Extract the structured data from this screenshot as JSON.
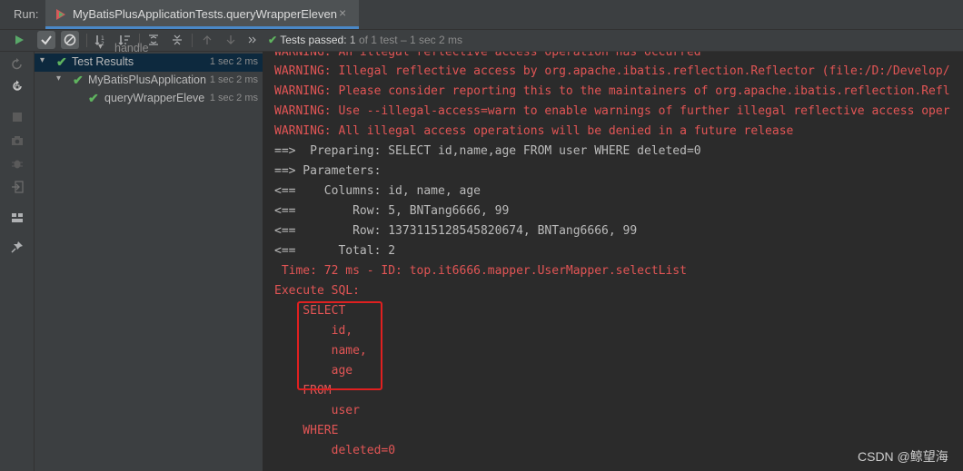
{
  "top": {
    "run_label": "Run:",
    "tab_title": "MyBatisPlusApplicationTests.queryWrapperEleven",
    "tab_close": "×"
  },
  "toolbar": {
    "status_passed": "Tests passed:",
    "status_count": "1",
    "status_detail": "of 1 test – 1 sec 2 ms"
  },
  "tree": {
    "partial_top": "handle",
    "items": [
      {
        "label": "Test Results",
        "duration": "1 sec 2 ms"
      },
      {
        "label": "MyBatisPlusApplication",
        "duration": "1 sec 2 ms"
      },
      {
        "label": "queryWrapperEleve",
        "duration": "1 sec 2 ms"
      }
    ]
  },
  "console": {
    "lines": [
      "WARNING: An illegal reflective access operation has occurred",
      "WARNING: Illegal reflective access by org.apache.ibatis.reflection.Reflector (file:/D:/Develop/",
      "WARNING: Please consider reporting this to the maintainers of org.apache.ibatis.reflection.Refl",
      "WARNING: Use --illegal-access=warn to enable warnings of further illegal reflective access oper",
      "WARNING: All illegal access operations will be denied in a future release",
      "==>  Preparing: SELECT id,name,age FROM user WHERE deleted=0",
      "==> Parameters: ",
      "<==    Columns: id, name, age",
      "<==        Row: 5, BNTang6666, 99",
      "<==        Row: 1373115128545820674, BNTang6666, 99",
      "<==      Total: 2",
      " Time: 72 ms - ID: top.it6666.mapper.UserMapper.selectList",
      "Execute SQL:",
      "    SELECT",
      "        id,",
      "        name,",
      "        age",
      "    FROM",
      "        user",
      "    WHERE",
      "        deleted=0"
    ]
  },
  "watermark": "CSDN @鲸望海",
  "colors": {
    "console_red": "#e25555",
    "console_grey": "#bbbbbb",
    "pass_green": "#5fb35f",
    "highlight_box": "#e02020"
  }
}
